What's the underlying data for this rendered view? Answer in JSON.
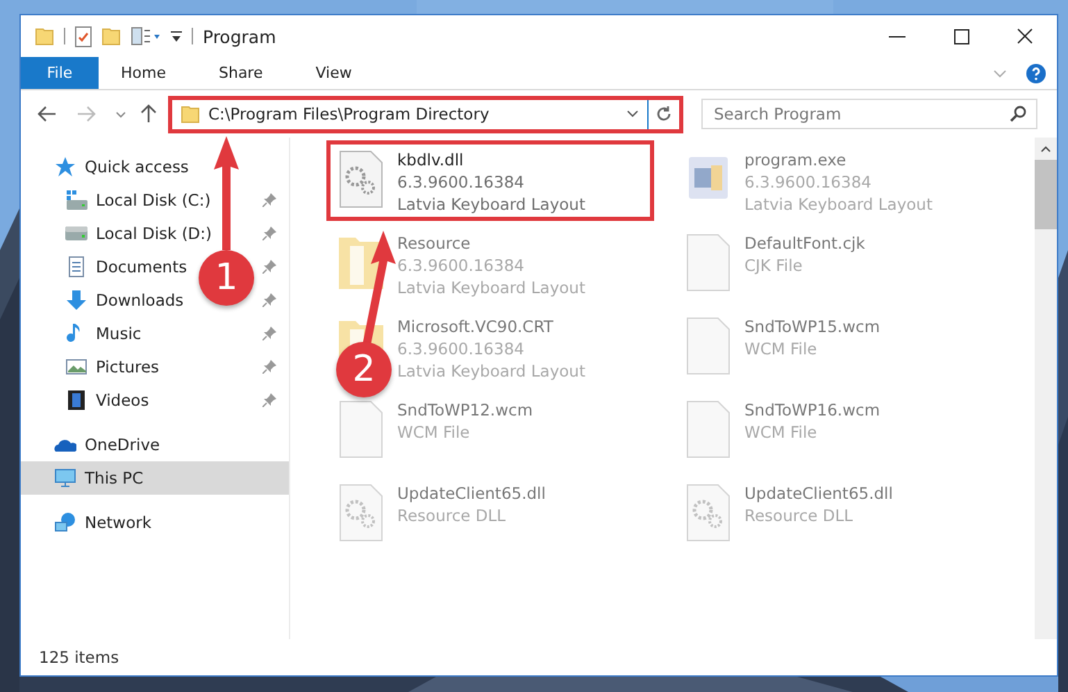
{
  "window": {
    "title": "Program"
  },
  "ribbon_tabs": [
    {
      "label": "File",
      "selected": true
    },
    {
      "label": "Home",
      "selected": false
    },
    {
      "label": "Share",
      "selected": false
    },
    {
      "label": "View",
      "selected": false
    }
  ],
  "address_bar": {
    "value": "C:\\Program Files\\Program Directory",
    "highlighted": true
  },
  "search": {
    "placeholder": "Search Program"
  },
  "sidebar": {
    "items": [
      {
        "label": "Quick access",
        "kind": "quick",
        "pinned": false,
        "selected": false,
        "children": [
          {
            "label": "Local Disk (C:)",
            "kind": "diskc",
            "pinned": true,
            "selected": false
          },
          {
            "label": "Local Disk (D:)",
            "kind": "disk",
            "pinned": true,
            "selected": false
          },
          {
            "label": "Documents",
            "kind": "documents",
            "pinned": true,
            "selected": false
          },
          {
            "label": "Downloads",
            "kind": "downloads",
            "pinned": true,
            "selected": false
          },
          {
            "label": "Music",
            "kind": "music",
            "pinned": true,
            "selected": false
          },
          {
            "label": "Pictures",
            "kind": "pictures",
            "pinned": true,
            "selected": false
          },
          {
            "label": "Videos",
            "kind": "videos",
            "pinned": true,
            "selected": false
          }
        ]
      },
      {
        "label": "OneDrive",
        "kind": "onedrive",
        "pinned": false,
        "selected": false
      },
      {
        "label": "This PC",
        "kind": "pc",
        "pinned": false,
        "selected": true
      },
      {
        "label": "Network",
        "kind": "network",
        "pinned": false,
        "selected": false
      }
    ]
  },
  "files": [
    {
      "name": "kbdlv.dll",
      "details": [
        "6.3.9600.16384",
        "Latvia Keyboard Layout"
      ],
      "kind": "dll",
      "blurred": false,
      "highlighted": true
    },
    {
      "name": "program.exe",
      "details": [
        "6.3.9600.16384",
        "Latvia Keyboard Layout"
      ],
      "kind": "exe",
      "blurred": true,
      "highlighted": false
    },
    {
      "name": "Resource",
      "details": [
        "6.3.9600.16384",
        "Latvia Keyboard Layout"
      ],
      "kind": "folder",
      "blurred": true,
      "highlighted": false
    },
    {
      "name": "DefaultFont.cjk",
      "details": [
        "CJK File"
      ],
      "kind": "file",
      "blurred": true,
      "highlighted": false
    },
    {
      "name": "Microsoft.VC90.CRT",
      "details": [
        "6.3.9600.16384",
        "Latvia Keyboard Layout"
      ],
      "kind": "folder",
      "blurred": true,
      "highlighted": false
    },
    {
      "name": "SndToWP15.wcm",
      "details": [
        "WCM File"
      ],
      "kind": "file",
      "blurred": true,
      "highlighted": false
    },
    {
      "name": "SndToWP12.wcm",
      "details": [
        "WCM File"
      ],
      "kind": "file",
      "blurred": true,
      "highlighted": false
    },
    {
      "name": "SndToWP16.wcm",
      "details": [
        "WCM File"
      ],
      "kind": "file",
      "blurred": true,
      "highlighted": false
    },
    {
      "name": "UpdateClient65.dll",
      "details": [
        "Resource DLL"
      ],
      "kind": "dll",
      "blurred": true,
      "highlighted": false
    },
    {
      "name": "UpdateClient65.dll",
      "details": [
        "Resource DLL"
      ],
      "kind": "dll",
      "blurred": true,
      "highlighted": false
    }
  ],
  "status_bar": {
    "item_count": "125 items"
  },
  "annotations": [
    {
      "number": "1"
    },
    {
      "number": "2"
    }
  ]
}
